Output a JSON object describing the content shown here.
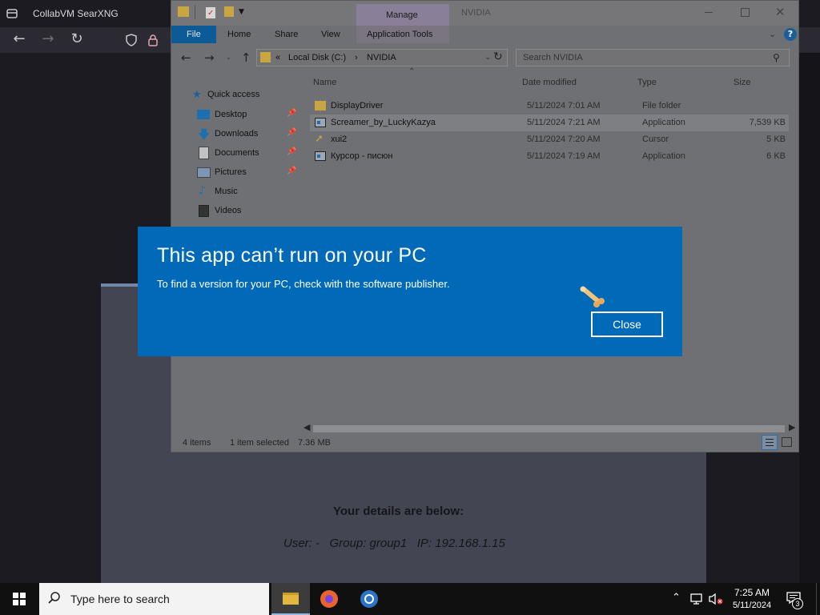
{
  "browser": {
    "tab_title": "CollabVM SearXNG",
    "colors": {
      "tabbar": "#1c1b22",
      "toolbar": "#2b2a33"
    }
  },
  "web_page": {
    "details_heading": "Your details are below:",
    "details_line": "User: -   Group: group1   IP: 192.168.1.15"
  },
  "explorer": {
    "title": "NVIDIA",
    "contextual_tab_group": "Manage",
    "ribbon_tabs": [
      "File",
      "Home",
      "Share",
      "View",
      "Application Tools"
    ],
    "address": {
      "prefix": "«",
      "segments": [
        "Local Disk (C:)",
        "NVIDIA"
      ]
    },
    "search_placeholder": "Search NVIDIA",
    "nav": {
      "quick_access": "Quick access",
      "items": [
        {
          "label": "Desktop",
          "icon": "desktop-icon",
          "pinned": true
        },
        {
          "label": "Downloads",
          "icon": "downloads-icon",
          "pinned": true
        },
        {
          "label": "Documents",
          "icon": "documents-icon",
          "pinned": true
        },
        {
          "label": "Pictures",
          "icon": "pictures-icon",
          "pinned": true
        },
        {
          "label": "Music",
          "icon": "music-icon",
          "pinned": false
        },
        {
          "label": "Videos",
          "icon": "videos-icon",
          "pinned": false
        }
      ]
    },
    "columns": {
      "name": "Name",
      "date": "Date modified",
      "type": "Type",
      "size": "Size"
    },
    "files": [
      {
        "name": "DisplayDriver",
        "date": "5/11/2024 7:01 AM",
        "type": "File folder",
        "size": "",
        "icon": "folder-icon",
        "selected": false
      },
      {
        "name": "Screamer_by_LuckyKazya",
        "date": "5/11/2024 7:21 AM",
        "type": "Application",
        "size": "7,539 KB",
        "icon": "application-icon",
        "selected": true
      },
      {
        "name": "xui2",
        "date": "5/11/2024 7:20 AM",
        "type": "Cursor",
        "size": "5 KB",
        "icon": "cursor-file-icon",
        "selected": false
      },
      {
        "name": "Курсор - писюн",
        "date": "5/11/2024 7:19 AM",
        "type": "Application",
        "size": "6 KB",
        "icon": "application-icon",
        "selected": false
      }
    ],
    "status": {
      "items": "4 items",
      "selected": "1 item selected",
      "size": "7.36 MB"
    }
  },
  "dialog": {
    "title": "This app can’t run on your PC",
    "message": "To find a version for your PC, check with the software publisher.",
    "close_label": "Close",
    "color": "#0069b8"
  },
  "taskbar": {
    "search_placeholder": "Type here to search",
    "time": "7:25 AM",
    "date": "5/11/2024",
    "notification_count": "3",
    "apps": [
      "file-explorer-icon",
      "firefox-icon",
      "chrome-icon"
    ]
  }
}
